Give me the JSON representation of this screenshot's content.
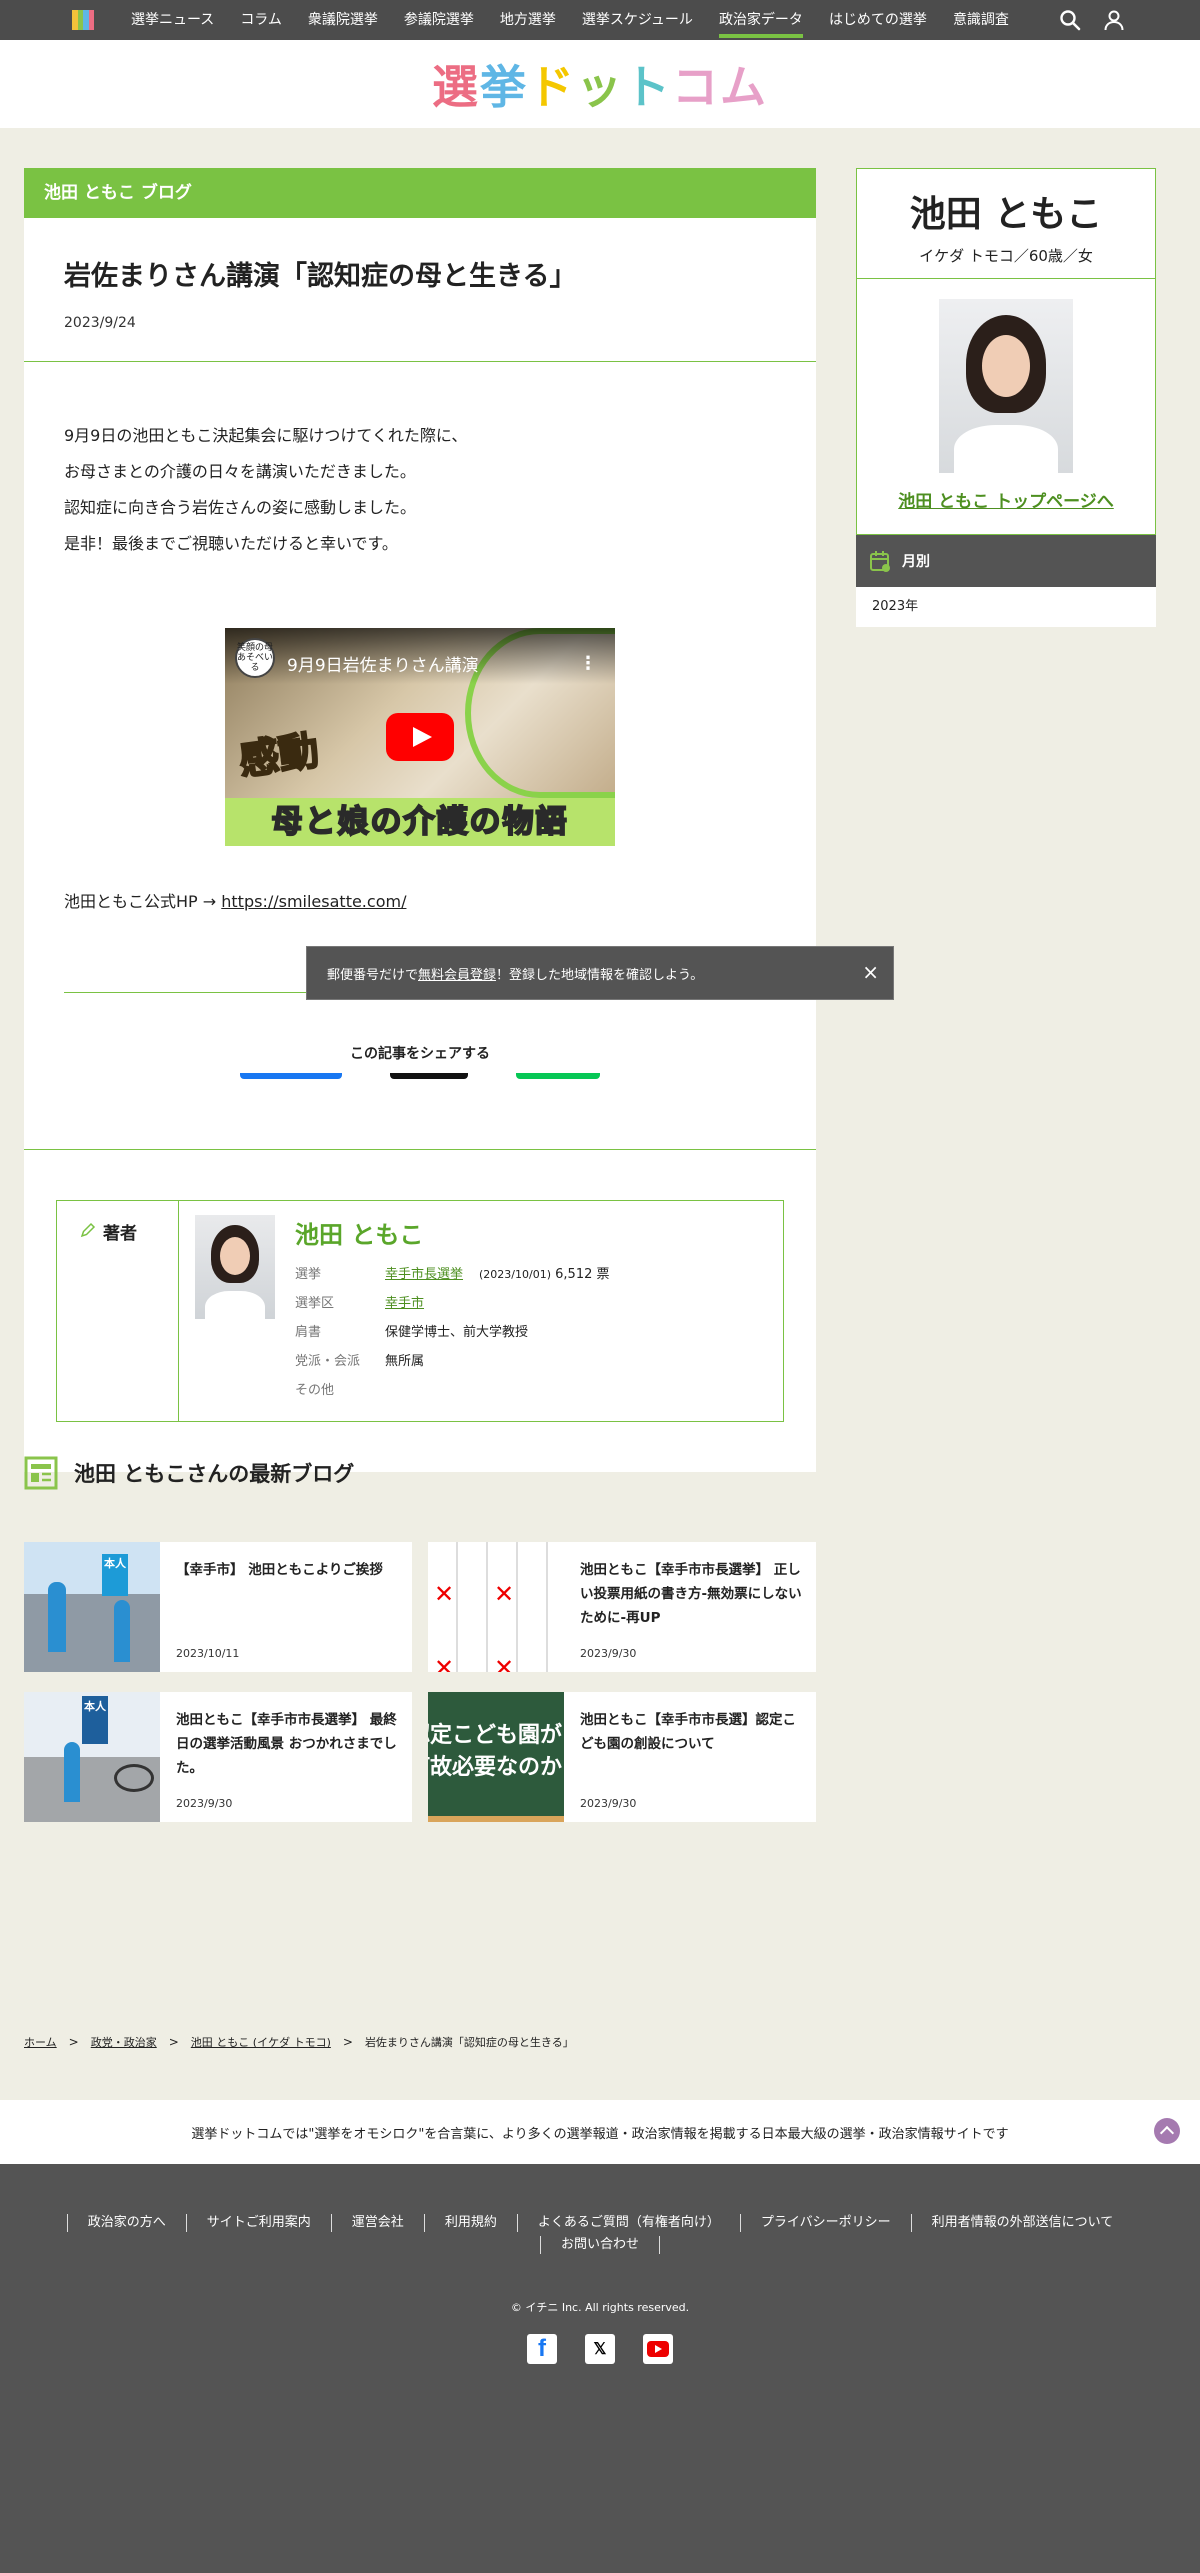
{
  "nav": {
    "items": [
      "選挙ニュース",
      "コラム",
      "衆議院選挙",
      "参議院選挙",
      "地方選挙",
      "選挙スケジュール",
      "政治家データ",
      "はじめての選挙",
      "意識調査"
    ],
    "active_index": 6
  },
  "logo": [
    "選",
    "挙",
    "ド",
    "ッ",
    "ト",
    "コム"
  ],
  "blog_header": "池田 ともこ ブログ",
  "article": {
    "title": "岩佐まりさん講演「認知症の母と生きる」",
    "date": "2023/9/24",
    "paragraphs": [
      "9月9日の池田ともこ決起集会に駆けつけてくれた際に、",
      "お母さまとの介護の日々を講演いただきました。",
      "認知症に向き合う岩佐さんの姿に感動しました。",
      "是非！最後までご視聴いただけると幸いです。"
    ],
    "video": {
      "title": "9月9日岩佐まりさん講演",
      "channel": "笑顔の母あそべいる",
      "badge": "感動",
      "caption": "母と娘の介護の物語"
    },
    "hp_label": "池田ともこ公式HP → ",
    "hp_url": "https://smilesatte.com/",
    "share_title": "この記事をシェアする"
  },
  "author": {
    "label": "著者",
    "name": "池田 ともこ",
    "rows": [
      {
        "k": "選挙",
        "link": "幸手市長選挙",
        "date": "(2023/10/01)",
        "extra": "6,512 票"
      },
      {
        "k": "選挙区",
        "link": "幸手市"
      },
      {
        "k": "肩書",
        "v": "保健学博士、前大学教授"
      },
      {
        "k": "党派・会派",
        "v": "無所属"
      },
      {
        "k": "その他",
        "v": ""
      }
    ]
  },
  "latest": {
    "heading": "池田 ともこさんの最新ブログ",
    "cards": [
      {
        "title": "【幸手市】 池田ともこよりご挨拶",
        "date": "2023/10/11"
      },
      {
        "title": "池田ともこ【幸手市市長選挙】 正しい投票用紙の書き方-無効票にしないために-再UP",
        "date": "2023/9/30"
      },
      {
        "title": "池田ともこ【幸手市市長選挙】 最終日の選挙活動風景 おつかれさまでした。",
        "date": "2023/9/30"
      },
      {
        "title": "池田ともこ【幸手市市長選】認定こども園の創設について",
        "date": "2023/9/30"
      }
    ],
    "thumb4_text": [
      "認定こども園が",
      "何故必要なのか"
    ],
    "thumb1_sign": "本人",
    "thumb3_sign": "本人"
  },
  "breadcrumb": [
    "ホーム",
    "政党・政治家",
    "池田 ともこ (イケダ トモコ)",
    "岩佐まりさん講演「認知症の母と生きる」"
  ],
  "tagline": "選挙ドットコムでは\"選挙をオモシロク\"を合言葉に、より多くの選挙報道・政治家情報を掲載する日本最大級の選挙・政治家情報サイトです",
  "footer": {
    "links": [
      "政治家の方へ",
      "サイトご利用案内",
      "運営会社",
      "利用規約",
      "よくあるご質問（有権者向け）",
      "プライバシーポリシー",
      "利用者情報の外部送信について",
      "お問い合わせ"
    ],
    "copyright": "© イチニ Inc. All rights reserved.",
    "social": [
      "f",
      "𝕏"
    ]
  },
  "sidebar": {
    "name": "池田 ともこ",
    "meta": "イケダ トモコ／60歳／女",
    "top_link": "池田 ともこ トップページへ",
    "monthly_label": "月別",
    "months": [
      "2023年"
    ]
  },
  "toast": {
    "before": "郵便番号だけで",
    "link": "無料会員登録",
    "after": "！登録した地域情報を確認しよう。",
    "close": "×"
  },
  "colors": {
    "accent_green": "#7ac243",
    "dark_gray": "#545454",
    "to_top": "#a57ab0"
  }
}
